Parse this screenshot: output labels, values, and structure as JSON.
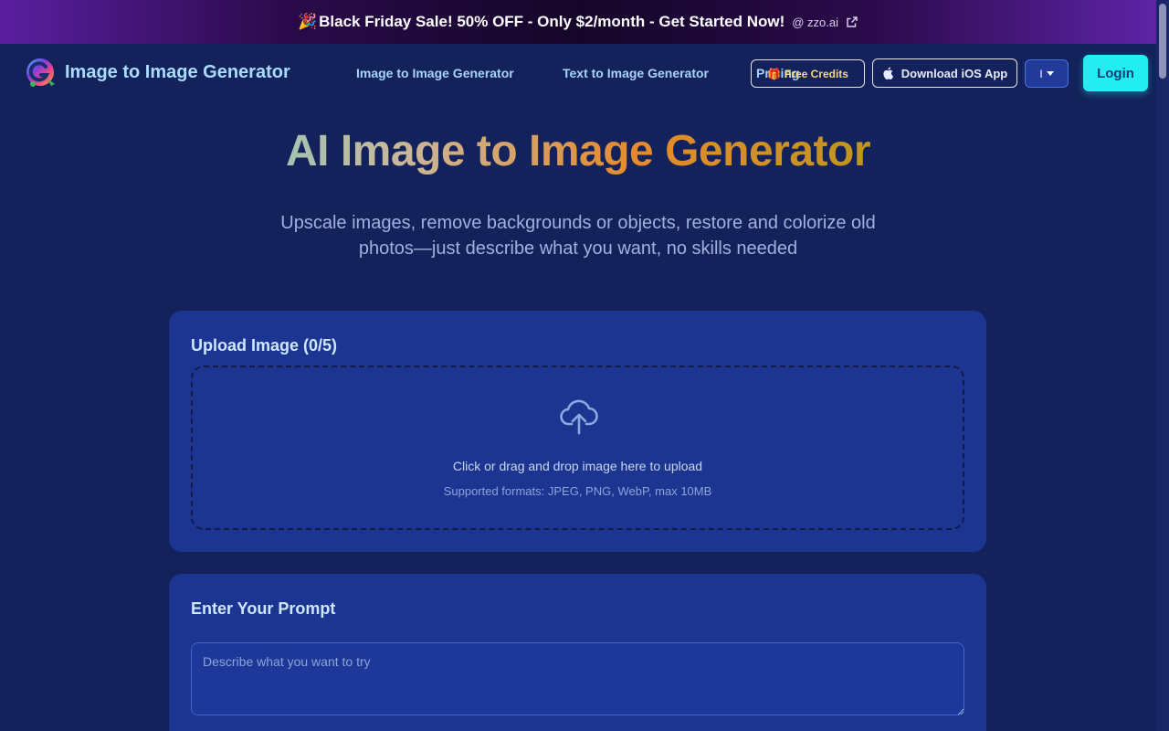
{
  "promo": {
    "emoji": "🎉",
    "text": "Black Friday Sale! 50% OFF - Only $2/month - Get Started Now!",
    "by": "@ zzo.ai",
    "ext_icon": "external-link-icon"
  },
  "nav": {
    "brand": "Image to Image Generator",
    "links": [
      {
        "label": "Image to Image Generator"
      },
      {
        "label": "Text to Image Generator"
      },
      {
        "label": "Pricing"
      }
    ],
    "credits_label": "Free Credits",
    "credits_icon": "🎁",
    "ios_label": "Download iOS App",
    "lang_label": "I",
    "login_label": "Login"
  },
  "hero": {
    "title": "AI Image to Image Generator",
    "subtitle": "Upscale images, remove backgrounds or objects, restore and colorize old photos—just describe what you want, no skills needed"
  },
  "upload": {
    "title": "Upload Image (0/5)",
    "main_text": "Click or drag and drop image here to upload",
    "formats": "Supported formats: JPEG, PNG, WebP, max 10MB"
  },
  "prompt": {
    "title": "Enter Your Prompt",
    "placeholder": "Describe what you want to try",
    "value": ""
  },
  "colors": {
    "background": "#13225a",
    "card": "#1b3591",
    "accent": "#22eef2",
    "credits": "#f6d97a"
  }
}
